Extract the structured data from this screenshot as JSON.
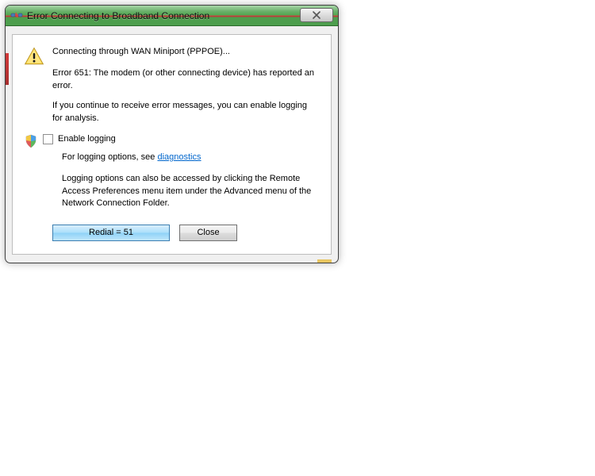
{
  "window": {
    "title": "Error Connecting to Broadband Connection"
  },
  "message": {
    "connecting": "Connecting through WAN Miniport (PPPOE)...",
    "error": "Error 651: The modem (or other connecting device) has reported an error.",
    "continue": "If you continue to receive error messages, you can enable logging for analysis."
  },
  "logging": {
    "checkbox_label": "Enable logging",
    "options_prefix": "For logging options, see ",
    "options_link": "diagnostics",
    "description": "Logging options can also be accessed by clicking the Remote Access Preferences menu item under the Advanced menu of the Network Connection Folder."
  },
  "buttons": {
    "redial": "Redial = 51",
    "close": "Close"
  }
}
